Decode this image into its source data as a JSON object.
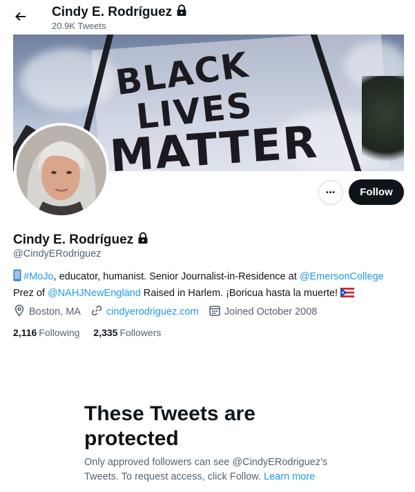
{
  "header": {
    "name": "Cindy E. Rodríguez",
    "tweet_count": "20.9K Tweets"
  },
  "banner": {
    "words": [
      "BLACK",
      "LIVES",
      "MATTER"
    ]
  },
  "profile": {
    "name": "Cindy E. Rodríguez",
    "handle": "@CindyERodriguez",
    "follow_label": "Follow",
    "more_label": "•••",
    "bio": {
      "line1_tag": "#MoJo",
      "line1_text": ", educator, humanist. Senior Journalist-in-Residence at ",
      "line1_mention": "@EmersonCollege",
      "line2_prefix": "Prez of ",
      "line2_mention": "@NAHJNewEngland",
      "line2_text": " Raised in Harlem. ¡Boricua hasta la muerte! "
    },
    "location": "Boston, MA",
    "website": "cindyerodriguez.com",
    "joined": "Joined October 2008",
    "following_count": "2,116",
    "following_label": "Following",
    "followers_count": "2,335",
    "followers_label": "Followers"
  },
  "protected": {
    "title": "These Tweets are protected",
    "text": "Only approved followers can see @CindyERodriguez’s Tweets. To request access, click Follow.",
    "learn_more": "Learn more"
  },
  "colors": {
    "accent": "#1d9bf0",
    "text_primary": "#0f1419",
    "text_secondary": "#536471",
    "follow_bg": "#0f1419"
  },
  "icons": [
    "back-arrow-icon",
    "lock-icon",
    "phone-icon",
    "puerto-rico-flag-icon",
    "location-icon",
    "link-icon",
    "calendar-icon"
  ]
}
